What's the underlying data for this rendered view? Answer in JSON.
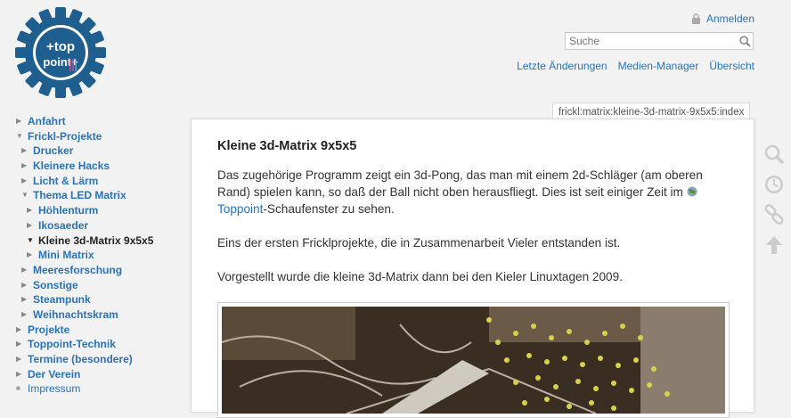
{
  "logo": {
    "line1": "+top",
    "line2": "point+"
  },
  "user_tools": {
    "login": "Anmelden"
  },
  "search": {
    "placeholder": "Suche"
  },
  "site_tools": [
    {
      "label": "Letzte Änderungen"
    },
    {
      "label": "Medien-Manager"
    },
    {
      "label": "Übersicht"
    }
  ],
  "sidebar": {
    "items": [
      {
        "label": "Anfahrt"
      },
      {
        "label": "Frickl-Projekte"
      },
      {
        "label": "Drucker"
      },
      {
        "label": "Kleinere Hacks"
      },
      {
        "label": "Licht & Lärm"
      },
      {
        "label": "Thema LED Matrix"
      },
      {
        "label": "Höhlenturm"
      },
      {
        "label": "Ikosaeder"
      },
      {
        "label": "Kleine 3d-Matrix 9x5x5"
      },
      {
        "label": "Mini Matrix"
      },
      {
        "label": "Meeresforschung"
      },
      {
        "label": "Sonstige"
      },
      {
        "label": "Steampunk"
      },
      {
        "label": "Weihnachtskram"
      },
      {
        "label": "Projekte"
      },
      {
        "label": "Toppoint-Technik"
      },
      {
        "label": "Termine (besondere)"
      },
      {
        "label": "Der Verein"
      },
      {
        "label": "Impressum"
      }
    ]
  },
  "page": {
    "id": "frickl:matrix:kleine-3d-matrix-9x5x5:index",
    "title": "Kleine 3d-Matrix 9x5x5",
    "p1_text": "Das zugehörige Programm zeigt ein 3d-Pong, das man mit einem 2d-Schläger (am oberen Rand) spielen kann, so daß der Ball nicht oben herausfliegt. Dies ist seit einiger Zeit im ",
    "p1_link": "Toppoint",
    "p1_tail": "-Schaufenster zu sehen.",
    "p2": "Eins der ersten Fricklprojekte, die in Zusammenarbeit Vieler entstanden ist.",
    "p3": "Vorgestellt wurde die kleine 3d-Matrix dann bei den Kieler Linuxtagen 2009."
  },
  "colors": {
    "link": "#2b73b7",
    "logo": "#1f5f8f",
    "background": "#f2f2f2"
  }
}
